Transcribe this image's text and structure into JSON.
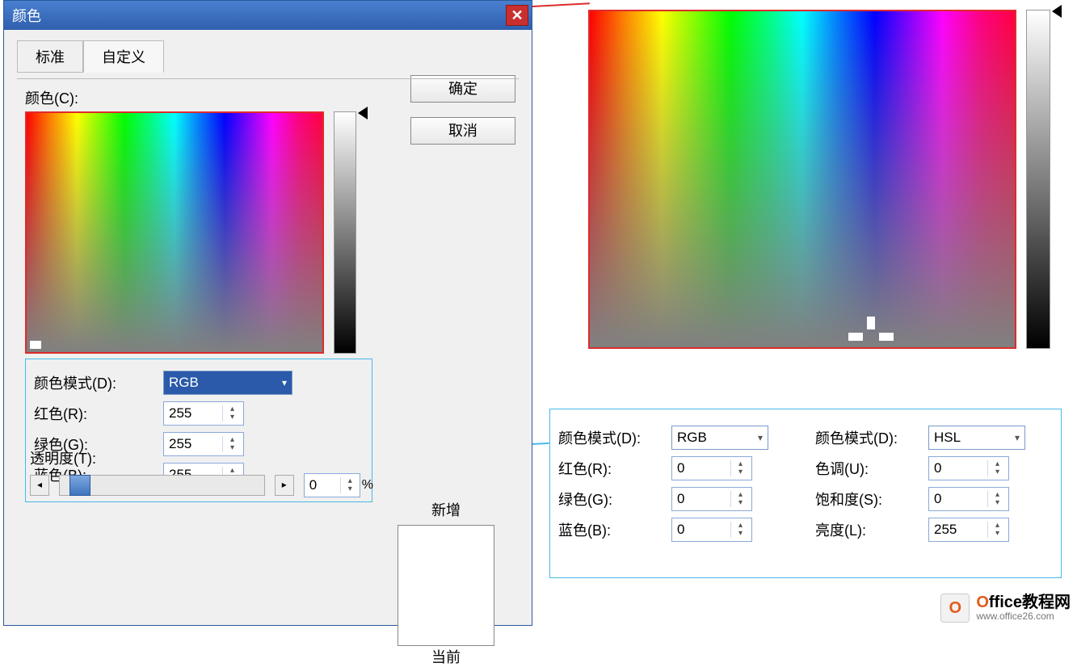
{
  "dialog": {
    "title": "颜色",
    "tabs": {
      "standard": "标准",
      "custom": "自定义"
    },
    "ok": "确定",
    "cancel": "取消",
    "colors_label": "颜色(C):",
    "mode_label": "颜色模式(D):",
    "mode_value": "RGB",
    "rgb": {
      "r_label": "红色(R):",
      "r_value": "255",
      "g_label": "绿色(G):",
      "g_value": "255",
      "b_label": "蓝色(B):",
      "b_value": "255"
    },
    "preview_new": "新增",
    "preview_current": "当前",
    "transparency_label": "透明度(T):",
    "transparency_value": "0",
    "transparency_unit": "%"
  },
  "modes": {
    "rgb": {
      "mode_label": "颜色模式(D):",
      "mode_value": "RGB",
      "r_label": "红色(R):",
      "r_value": "0",
      "g_label": "绿色(G):",
      "g_value": "0",
      "b_label": "蓝色(B):",
      "b_value": "0"
    },
    "hsl": {
      "mode_label": "颜色模式(D):",
      "mode_value": "HSL",
      "h_label": "色调(U):",
      "h_value": "0",
      "s_label": "饱和度(S):",
      "s_value": "0",
      "l_label": "亮度(L):",
      "l_value": "255"
    }
  },
  "watermark": {
    "brand_prefix": "O",
    "brand_rest": "ffice教程网",
    "url": "www.office26.com"
  }
}
